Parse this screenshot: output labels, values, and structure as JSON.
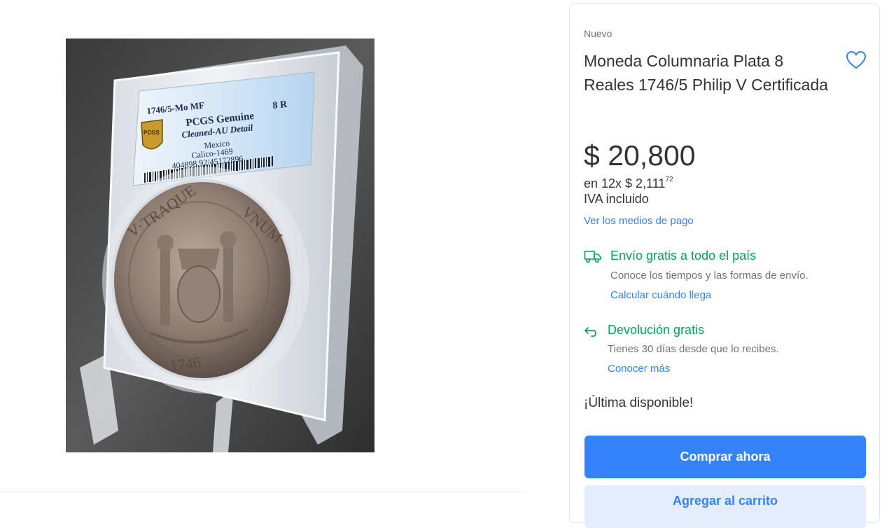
{
  "product": {
    "condition": "Nuevo",
    "title": "Moneda Columnaria Plata 8 Reales 1746/5 Philip V Certificada",
    "price": "$ 20,800",
    "installments_prefix": "en 12x $ 2,111",
    "installments_cents": "72",
    "tax_note": "IVA incluido",
    "payment_link": "Ver los medios de pago"
  },
  "shipping": {
    "title": "Envío gratis a todo el país",
    "description": "Conoce los tiempos y las formas de envío.",
    "link": "Calcular cuándo llega",
    "icon": "truck-icon"
  },
  "returns": {
    "title": "Devolución gratis",
    "description": "Tienes 30 días desde que lo recibes.",
    "link": "Conocer más",
    "icon": "return-arrow-icon"
  },
  "stock_text": "¡Última disponible!",
  "buttons": {
    "buy": "Comprar ahora",
    "cart": "Agregar al carrito"
  },
  "photo_label": {
    "line1": "1746/5-Mo MF",
    "grade_mark": "8 R",
    "line2": "PCGS Genuine",
    "line3": "Cleaned-AU Detail",
    "line4": "Mexico",
    "line5": "Calico-1469",
    "line6": "404898.92/45172896",
    "logo": "PCGS"
  },
  "colors": {
    "accent": "#3483fa",
    "success": "#00a650"
  }
}
